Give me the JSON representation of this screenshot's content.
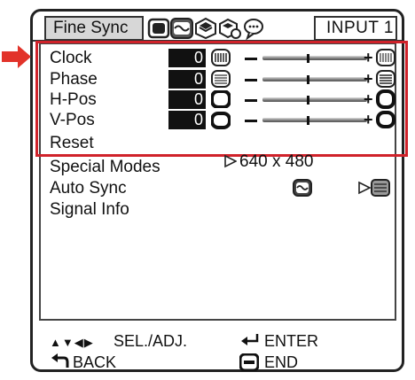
{
  "header": {
    "active_tab": "Fine Sync",
    "tab_icons": [
      "picture-icon",
      "sync-icon",
      "setup-icon",
      "options-icon",
      "language-icon"
    ],
    "input_label": "INPUT 1"
  },
  "menu": {
    "items": [
      {
        "label": "Clock",
        "value": "0",
        "icon": "clock-icon"
      },
      {
        "label": "Phase",
        "value": "0",
        "icon": "phase-icon"
      },
      {
        "label": "H-Pos",
        "value": "0",
        "icon": "hpos-icon"
      },
      {
        "label": "V-Pos",
        "value": "0",
        "icon": "vpos-icon"
      }
    ],
    "reset_label": "Reset",
    "special_modes_label": "Special Modes",
    "special_modes_value": "640 x 480",
    "auto_sync_label": "Auto Sync",
    "signal_info_label": "Signal Info",
    "slider_minus": "–",
    "slider_plus": "+"
  },
  "footer": {
    "select_glyphs": "▲▼◀▶",
    "select_label": "SEL./ADJ.",
    "enter_label": "ENTER",
    "back_label": "BACK",
    "end_label": "END"
  },
  "colors": {
    "highlight": "#d0222a",
    "pointer_arrow": "#e2332a"
  }
}
